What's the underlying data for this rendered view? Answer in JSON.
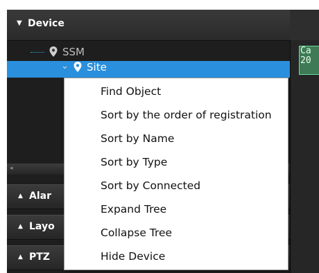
{
  "device_panel": {
    "header_label": "Device",
    "tree": [
      {
        "label": "SSM"
      },
      {
        "label": "Site"
      }
    ]
  },
  "sections": [
    {
      "label": "Alar"
    },
    {
      "label": "Layo"
    },
    {
      "label": "PTZ"
    }
  ],
  "camera_overlay": {
    "line1": "Ca",
    "line2": "20"
  },
  "context_menu": {
    "items": [
      "Find Object",
      "Sort by the order of registration",
      "Sort by Name",
      "Sort by Type",
      "Sort by Connected",
      "Expand Tree",
      "Collapse Tree",
      "Hide Device"
    ]
  },
  "colors": {
    "selection": "#2a8fdc",
    "panel_bg": "#1e1e1e",
    "menu_bg": "#ffffff"
  },
  "icons": [
    "triangle-down-icon",
    "location-pin-icon",
    "chevron-down-icon",
    "triangle-up-icon"
  ]
}
